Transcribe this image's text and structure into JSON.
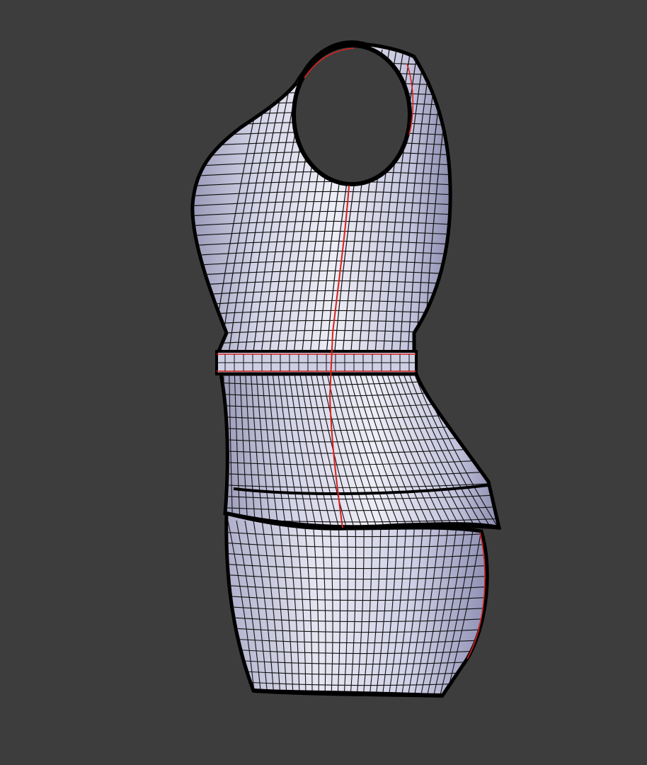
{
  "viewport": {
    "background_color": "#3d3d3d"
  },
  "model": {
    "subject": "dress-mesh",
    "surface_color": "#c8c8e2",
    "surface_highlight": "#eeeef6",
    "surface_shadow": "#9a9ab8",
    "wire_color": "#111111",
    "seam_color": "#d8201c"
  }
}
